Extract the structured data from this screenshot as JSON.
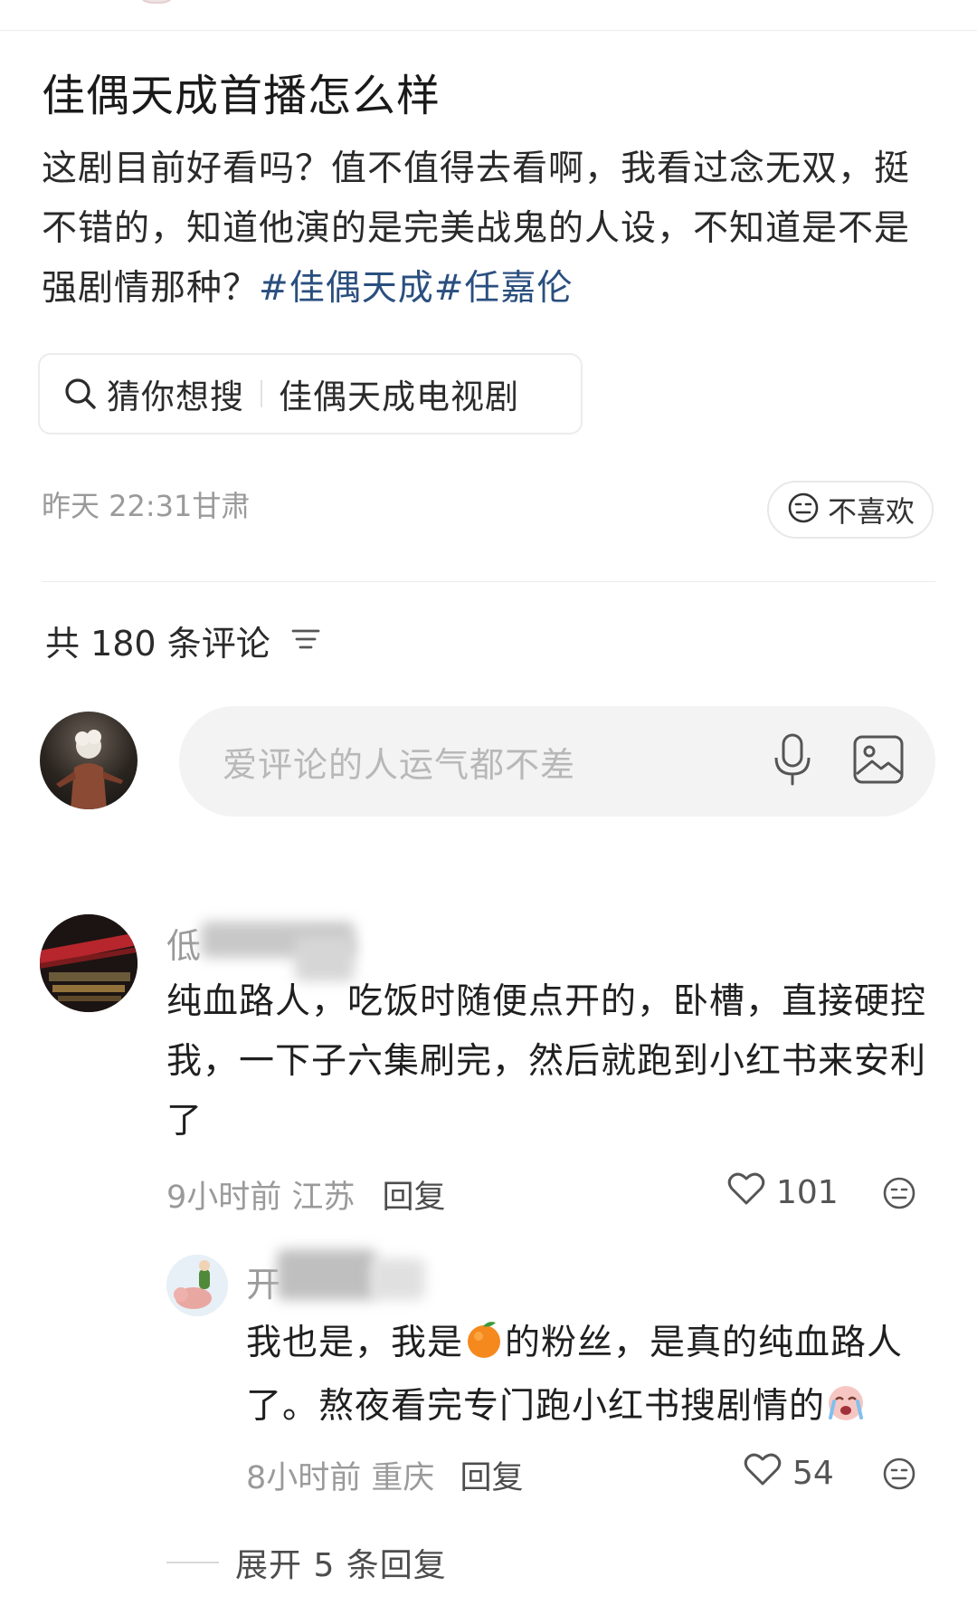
{
  "post": {
    "title": "佳偶天成首播怎么样",
    "body": "这剧目前好看吗？值不值得去看啊，我看过念无双，挺不错的，知道他演的是完美战鬼的人设，不知道是不是强剧情那种？",
    "tags": "#佳偶天成#任嘉伦",
    "meta": "昨天 22:31甘肃",
    "dislike_label": "不喜欢"
  },
  "search_chip": {
    "label": "猜你想搜",
    "query": "佳偶天成电视剧"
  },
  "comments_header": {
    "count_label": "共 180 条评论"
  },
  "comment_input": {
    "placeholder": "爱评论的人运气都不差"
  },
  "comment": {
    "author_visible": "低",
    "text": "纯血路人，吃饭时随便点开的，卧槽，直接硬控我，一下子六集刷完，然后就跑到小红书来安利了",
    "time": "9小时前",
    "location": "江苏",
    "reply_label": "回复",
    "likes": "101"
  },
  "reply": {
    "author_visible": "开",
    "text_part1": "我也是，我是",
    "text_part2": "的粉丝，是真的纯血路人了。熬夜看完专门跑小红书搜剧情的",
    "time": "8小时前",
    "location": "重庆",
    "reply_label": "回复",
    "likes": "54"
  },
  "expand": {
    "label": "展开 5 条回复"
  },
  "colors": {
    "tag": "#2a4f7f",
    "muted": "#9a9a9a",
    "input_bg": "#f3f3f3"
  }
}
